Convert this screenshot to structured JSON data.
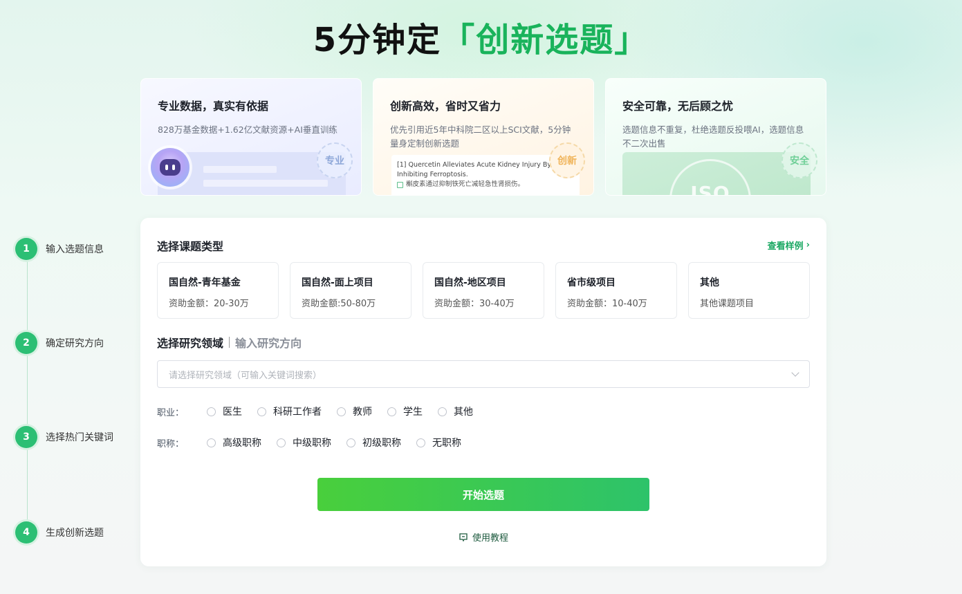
{
  "headline": {
    "prefix": "5分钟定",
    "accent": "「创新选题」"
  },
  "features": [
    {
      "title": "专业数据，真实有依据",
      "desc": "828万基金数据+1.62亿文献资源+AI垂直训练",
      "stamp": "专业"
    },
    {
      "title": "创新高效，省时又省力",
      "desc": "优先引用近5年中科院二区以上SCI文献，5分钟量身定制创新选题",
      "stamp": "创新",
      "ref_en": "[1] Quercetin Alleviates Acute Kidney Injury By Inhibiting Ferroptosis.",
      "ref_cn": "槲皮素通过抑制铁死亡减轻急性肾损伤。"
    },
    {
      "title": "安全可靠，无后顾之忧",
      "desc": "选题信息不重复，杜绝选题反投喂AI，选题信息不二次出售",
      "stamp": "安全",
      "badge": "ISO"
    }
  ],
  "steps": [
    {
      "num": "1",
      "label": "输入选题信息"
    },
    {
      "num": "2",
      "label": "确定研究方向"
    },
    {
      "num": "3",
      "label": "选择热门关键词"
    },
    {
      "num": "4",
      "label": "生成创新选题"
    }
  ],
  "form": {
    "type_title": "选择课题类型",
    "view_sample": "查看样例",
    "types": [
      {
        "name": "国自然-青年基金",
        "desc": "资助金额：20-30万"
      },
      {
        "name": "国自然-面上项目",
        "desc": "资助金额:50-80万"
      },
      {
        "name": "国自然-地区项目",
        "desc": "资助金额：30-40万"
      },
      {
        "name": "省市级项目",
        "desc": "资助金额：10-40万"
      },
      {
        "name": "其他",
        "desc": "其他课题项目"
      }
    ],
    "field_tab_active": "选择研究领域",
    "field_tab_inactive": "输入研究方向",
    "field_placeholder": "请选择研究领域（可输入关键词搜索）",
    "occupation_label": "职业：",
    "occupations": [
      "医生",
      "科研工作者",
      "教师",
      "学生",
      "其他"
    ],
    "title_label": "职称：",
    "titles": [
      "高级职称",
      "中级职称",
      "初级职称",
      "无职称"
    ],
    "start_button": "开始选题",
    "tutorial": "使用教程"
  }
}
